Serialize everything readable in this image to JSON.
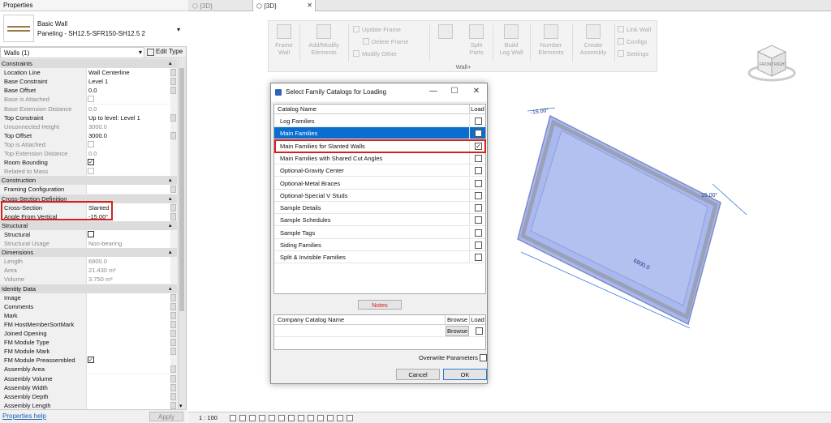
{
  "properties": {
    "title": "Properties",
    "type_name_line1": "Basic Wall",
    "type_name_line2": "Paneling - SH12.5-SFR150-SH12.5 2",
    "instance_selector": "Walls (1)",
    "edit_type_label": "Edit Type",
    "help_link": "Properties help",
    "apply_label": "Apply",
    "rows": [
      {
        "kind": "section",
        "label": "Constraints"
      },
      {
        "kind": "param",
        "label": "Location Line",
        "value": "Wall Centerline",
        "editable": true
      },
      {
        "kind": "param",
        "label": "Base Constraint",
        "value": "Level 1",
        "editable": true
      },
      {
        "kind": "param",
        "label": "Base Offset",
        "value": "0.0",
        "editable": true
      },
      {
        "kind": "param",
        "label": "Base is Attached",
        "value": "",
        "editable": false,
        "checkbox": true
      },
      {
        "kind": "param",
        "label": "Base Extension Distance",
        "value": "0.0",
        "editable": false
      },
      {
        "kind": "param",
        "label": "Top Constraint",
        "value": "Up to level: Level 1",
        "editable": true
      },
      {
        "kind": "param",
        "label": "Unconnected Height",
        "value": "3000.0",
        "editable": false
      },
      {
        "kind": "param",
        "label": "Top Offset",
        "value": "3000.0",
        "editable": true
      },
      {
        "kind": "param",
        "label": "Top is Attached",
        "value": "",
        "editable": false,
        "checkbox": true
      },
      {
        "kind": "param",
        "label": "Top Extension Distance",
        "value": "0.0",
        "editable": false
      },
      {
        "kind": "param",
        "label": "Room Bounding",
        "value": "",
        "editable": true,
        "checkbox": true,
        "checked": true
      },
      {
        "kind": "param",
        "label": "Related to Mass",
        "value": "",
        "editable": false,
        "checkbox": true
      },
      {
        "kind": "section",
        "label": "Construction"
      },
      {
        "kind": "param",
        "label": "Framing Configuration",
        "value": "",
        "editable": true
      },
      {
        "kind": "section",
        "label": "Cross-Section Definition"
      },
      {
        "kind": "param",
        "label": "Cross-Section",
        "value": "Slanted",
        "editable": true
      },
      {
        "kind": "param",
        "label": "Angle From Vertical",
        "value": "-15.00°",
        "editable": true
      },
      {
        "kind": "section",
        "label": "Structural"
      },
      {
        "kind": "param",
        "label": "Structural",
        "value": "",
        "editable": true,
        "checkbox": true
      },
      {
        "kind": "param",
        "label": "Structural Usage",
        "value": "Non-bearing",
        "editable": false
      },
      {
        "kind": "section",
        "label": "Dimensions"
      },
      {
        "kind": "param",
        "label": "Length",
        "value": "6900.0",
        "editable": false
      },
      {
        "kind": "param",
        "label": "Area",
        "value": "21.430 m²",
        "editable": false
      },
      {
        "kind": "param",
        "label": "Volume",
        "value": "3.750 m³",
        "editable": false
      },
      {
        "kind": "section",
        "label": "Identity Data"
      },
      {
        "kind": "param",
        "label": "Image",
        "value": "",
        "editable": true
      },
      {
        "kind": "param",
        "label": "Comments",
        "value": "",
        "editable": true
      },
      {
        "kind": "param",
        "label": "Mark",
        "value": "",
        "editable": true
      },
      {
        "kind": "param",
        "label": "FM HostMemberSortMark",
        "value": "",
        "editable": true
      },
      {
        "kind": "param",
        "label": "Joined Opening",
        "value": "",
        "editable": true
      },
      {
        "kind": "param",
        "label": "FM Module Type",
        "value": "",
        "editable": true
      },
      {
        "kind": "param",
        "label": "FM Module Mark",
        "value": "",
        "editable": true
      },
      {
        "kind": "param",
        "label": "FM Module Preassembled",
        "value": "",
        "editable": true,
        "checkbox": true,
        "checked": true
      },
      {
        "kind": "param",
        "label": "Assembly Area",
        "value": "",
        "editable": true
      },
      {
        "kind": "param",
        "label": "Assembly Volume",
        "value": "",
        "editable": true
      },
      {
        "kind": "param",
        "label": "Assembly Width",
        "value": "",
        "editable": true
      },
      {
        "kind": "param",
        "label": "Assembly Depth",
        "value": "",
        "editable": true
      },
      {
        "kind": "param",
        "label": "Assembly Length",
        "value": "",
        "editable": true
      }
    ]
  },
  "tabs": [
    {
      "label": "{3D}",
      "active": false
    },
    {
      "label": "{3D}",
      "active": true
    }
  ],
  "ribbon": {
    "panel_label": "Wall+",
    "buttons": [
      {
        "label1": "Frame",
        "label2": "Wall"
      },
      {
        "label1": "Add/Modify",
        "label2": "Elements"
      },
      {
        "label1": "Split",
        "label2": "Parts"
      },
      {
        "label1": "Build",
        "label2": "Log Wall"
      },
      {
        "label1": "Number",
        "label2": "Elements"
      },
      {
        "label1": "Create",
        "label2": "Assembly"
      }
    ],
    "small_buttons": [
      {
        "label": "Update Frame"
      },
      {
        "label": "Delete Frame"
      },
      {
        "label": "Modify Other"
      },
      {
        "label": "Link Wall"
      },
      {
        "label": "Configs"
      },
      {
        "label": "Settings"
      }
    ]
  },
  "view_cube": {
    "face1": "FRONT",
    "face2": "RIGHT"
  },
  "viewport": {
    "dim_length": "6900.0",
    "angle_left": "-15.00°",
    "angle_right": "15.00°"
  },
  "dialog": {
    "title": "Select Family Catalogs for Loading",
    "col_name": "Catalog Name",
    "col_load": "Load",
    "catalogs": [
      {
        "name": "Log Families",
        "checked": false,
        "selected": false
      },
      {
        "name": "Main Families",
        "checked": false,
        "selected": true
      },
      {
        "name": "Main Families for Slanted Walls",
        "checked": true,
        "selected": false
      },
      {
        "name": "Main Families with Shared Cut Angles",
        "checked": false,
        "selected": false
      },
      {
        "name": "Optional-Gravity Center",
        "checked": false,
        "selected": false
      },
      {
        "name": "Optional-Metal Braces",
        "checked": false,
        "selected": false
      },
      {
        "name": "Optional-Special V Studs",
        "checked": false,
        "selected": false
      },
      {
        "name": "Sample Details",
        "checked": false,
        "selected": false
      },
      {
        "name": "Sample Schedules",
        "checked": false,
        "selected": false
      },
      {
        "name": "Sample Tags",
        "checked": false,
        "selected": false
      },
      {
        "name": "Siding Families",
        "checked": false,
        "selected": false
      },
      {
        "name": "Split & Invisible Families",
        "checked": false,
        "selected": false
      }
    ],
    "notes_label": "Notes",
    "company_col": "Company Catalog Name",
    "browse_col": "Browse",
    "load_col": "Load",
    "browse_btn": "Browse",
    "overwrite_label": "Overwrite Parameters",
    "cancel_label": "Cancel",
    "ok_label": "OK"
  },
  "status": {
    "scale": "1 : 100"
  },
  "colors": {
    "highlight_red": "#d62020",
    "selection_blue": "#0a6ed1",
    "wall_fill": "#a9b8ee"
  }
}
